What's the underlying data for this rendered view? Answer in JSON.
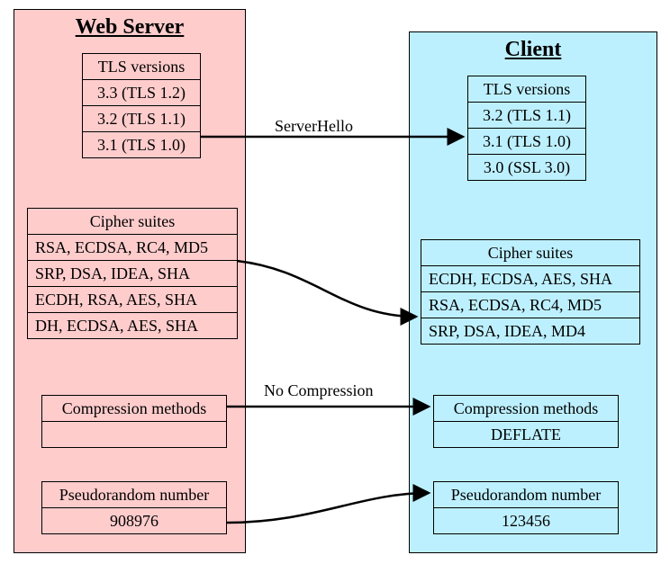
{
  "server": {
    "title": "Web Server",
    "tls": {
      "header": "TLS versions",
      "rows": [
        "3.3 (TLS 1.2)",
        "3.2 (TLS 1.1)",
        "3.1 (TLS 1.0)"
      ]
    },
    "cipher": {
      "header": "Cipher suites",
      "rows": [
        "RSA, ECDSA, RC4, MD5",
        "SRP, DSA, IDEA, SHA",
        "ECDH, RSA, AES, SHA",
        "DH, ECDSA, AES, SHA"
      ]
    },
    "compression": {
      "header": "Compression methods",
      "rows": [
        " "
      ]
    },
    "prn": {
      "header": "Pseudorandom number",
      "rows": [
        "908976"
      ]
    }
  },
  "client": {
    "title": "Client",
    "tls": {
      "header": "TLS versions",
      "rows": [
        "3.2 (TLS 1.1)",
        "3.1 (TLS 1.0)",
        "3.0 (SSL 3.0)"
      ]
    },
    "cipher": {
      "header": "Cipher suites",
      "rows": [
        "ECDH, ECDSA, AES, SHA",
        "RSA, ECDSA, RC4, MD5",
        "SRP, DSA, IDEA, MD4"
      ]
    },
    "compression": {
      "header": "Compression methods",
      "rows": [
        "DEFLATE"
      ]
    },
    "prn": {
      "header": "Pseudorandom number",
      "rows": [
        "123456"
      ]
    }
  },
  "labels": {
    "serverHello": "ServerHello",
    "noCompression": "No Compression"
  }
}
